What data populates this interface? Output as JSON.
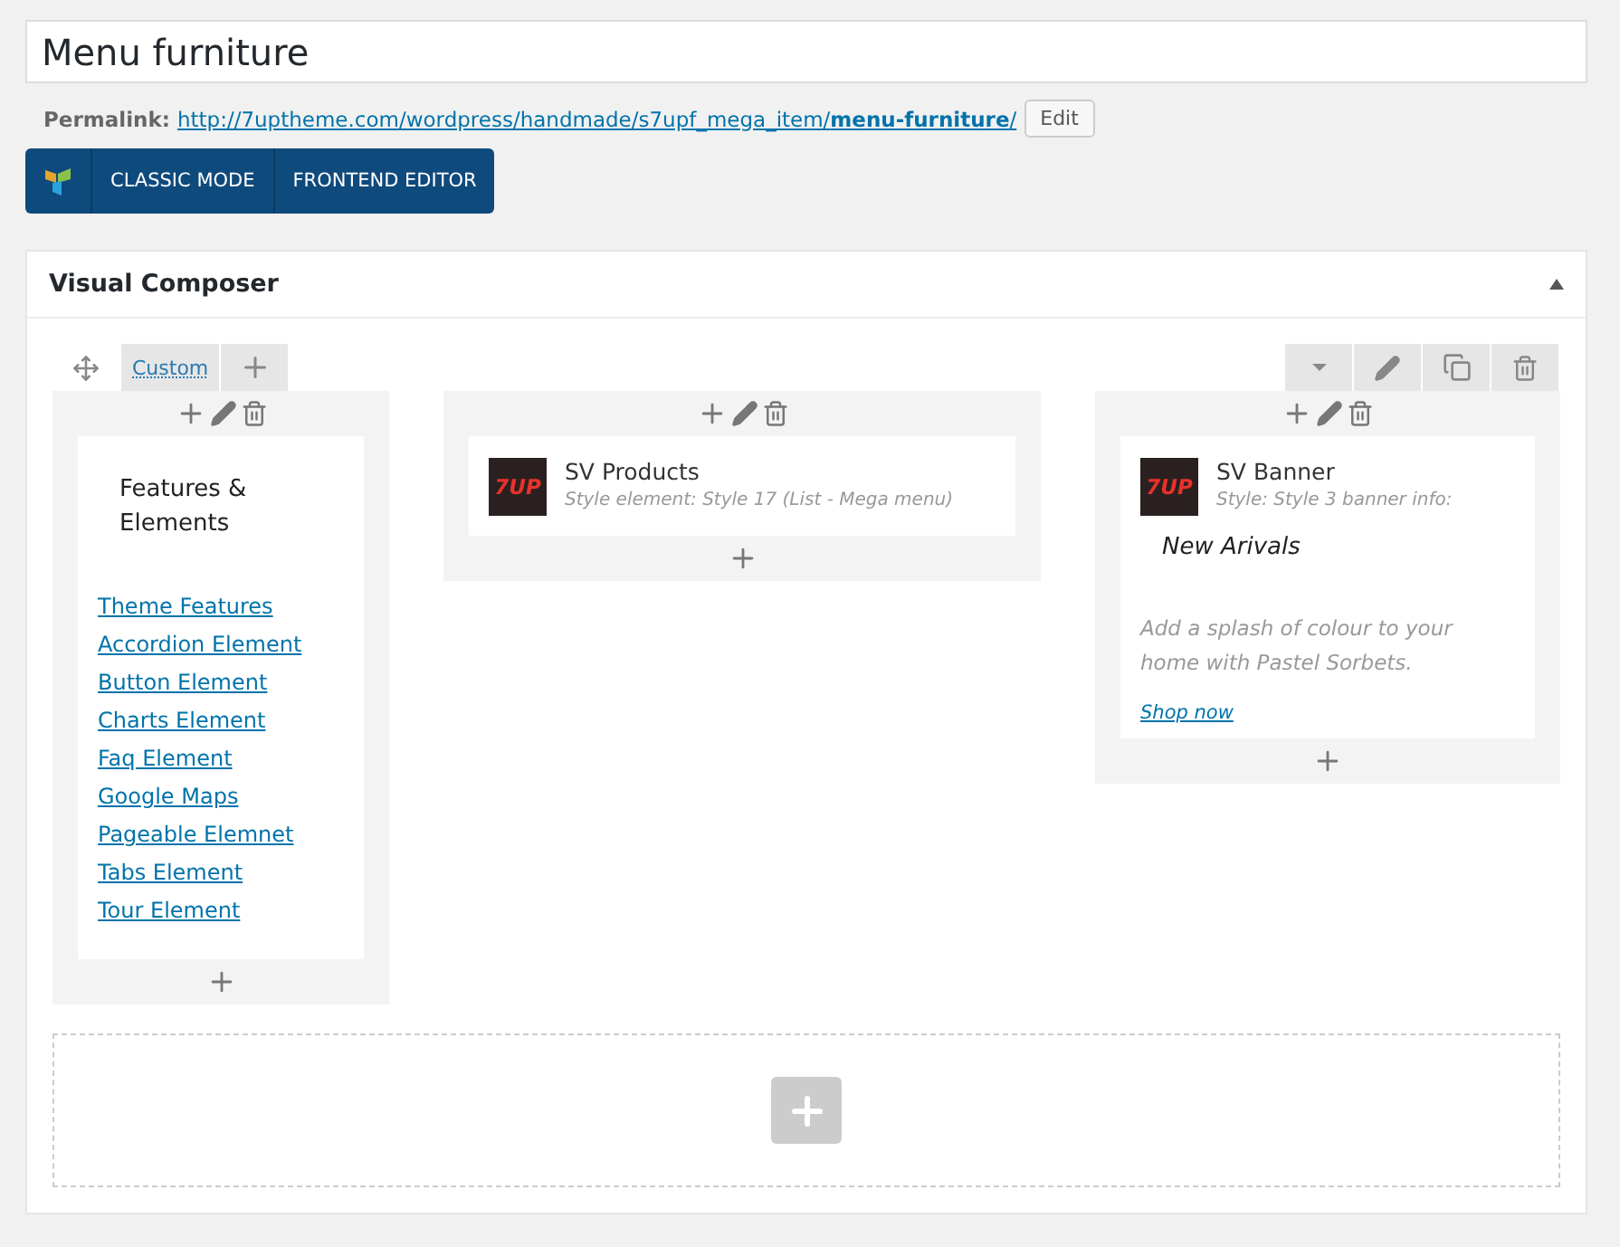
{
  "title_field": {
    "value": "Menu furniture"
  },
  "permalink": {
    "label": "Permalink:",
    "url": "http://7uptheme.com/wordpress/handmade/s7upf_mega_item/**menu-furniture**/",
    "edit_button": "Edit"
  },
  "editor_buttons": [
    "CLASSIC MODE",
    "FRONTEND EDITOR"
  ],
  "panel": {
    "title": "Visual Composer",
    "expanded": true
  },
  "row": {
    "layout_label": "Custom",
    "columns": [
      {
        "kind": "text",
        "heading": "Features & Elements",
        "links": [
          "Theme Features",
          "Accordion Element",
          "Button Element",
          "Charts Element",
          "Faq Element",
          "Google Maps",
          "Pageable Elemnet",
          "Tabs Element",
          "Tour Element"
        ]
      },
      {
        "kind": "element",
        "logo": "7UP",
        "name": "SV Products",
        "subtitle": "Style element: Style 17 (List - Mega menu)"
      },
      {
        "kind": "banner",
        "logo": "7UP",
        "name": "SV Banner",
        "subtitle": "Style: Style 3  banner info:",
        "banner_title": "New Arivals",
        "description": "Add a splash of colour to your home with Pastel Sorbets.",
        "link": "Shop now"
      }
    ]
  }
}
